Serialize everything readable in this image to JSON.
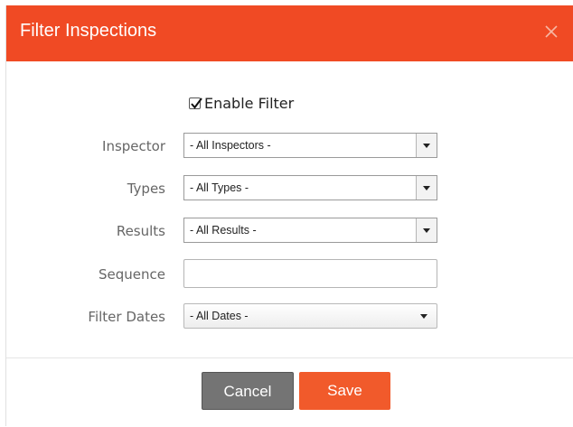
{
  "dialog": {
    "title": "Filter Inspections"
  },
  "enable_filter": {
    "label": "Enable Filter",
    "checked": true
  },
  "fields": {
    "inspector": {
      "label": "Inspector",
      "value": "- All Inspectors -"
    },
    "types": {
      "label": "Types",
      "value": "- All Types -"
    },
    "results": {
      "label": "Results",
      "value": "- All Results -"
    },
    "sequence": {
      "label": "Sequence",
      "value": ""
    },
    "filter_dates": {
      "label": "Filter Dates",
      "value": "- All Dates -"
    }
  },
  "buttons": {
    "cancel": "Cancel",
    "save": "Save"
  },
  "colors": {
    "header": "#f04a24",
    "save": "#f15a2b",
    "cancel": "#747474"
  },
  "icons": {
    "close": "close-icon",
    "checkmark": "checkmark-icon",
    "dropdown": "chevron-down-icon"
  }
}
